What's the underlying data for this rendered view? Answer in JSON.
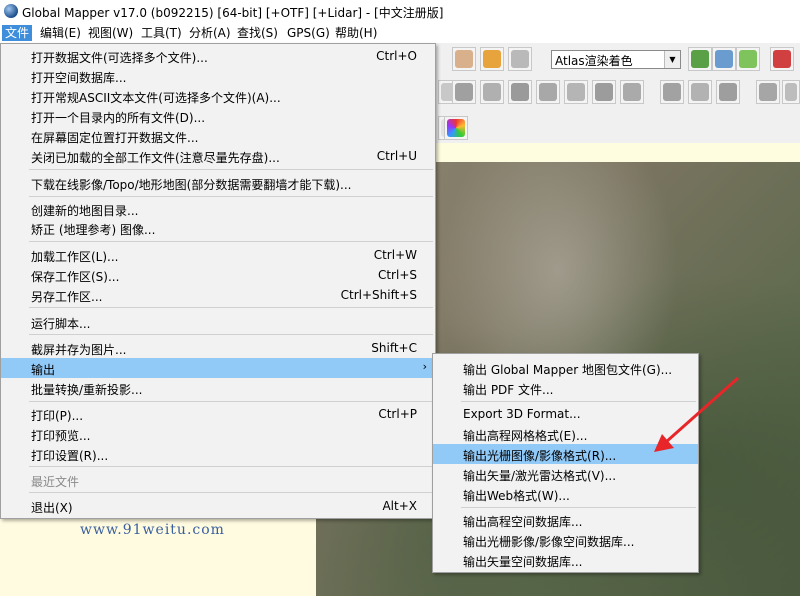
{
  "window": {
    "title": "Global Mapper v17.0 (b092215) [64-bit] [+OTF] [+Lidar] - [中文注册版]"
  },
  "menubar": [
    {
      "label": "文件",
      "active": true
    },
    {
      "label": "编辑(E)"
    },
    {
      "label": "视图(W)"
    },
    {
      "label": "工具(T)"
    },
    {
      "label": "分析(A)"
    },
    {
      "label": "查找(S)"
    },
    {
      "label": "GPS(G)"
    },
    {
      "label": "帮助(H)"
    }
  ],
  "toolbar": {
    "render_mode": "Atlas渲染着色"
  },
  "file_menu": [
    {
      "label": "打开数据文件(可选择多个文件)...",
      "shortcut": "Ctrl+O"
    },
    {
      "label": "打开空间数据库...",
      "shortcut": ""
    },
    {
      "label": "打开常规ASCII文本文件(可选择多个文件)(A)...",
      "shortcut": ""
    },
    {
      "label": "打开一个目录内的所有文件(D)...",
      "shortcut": ""
    },
    {
      "label": "在屏幕固定位置打开数据文件...",
      "shortcut": ""
    },
    {
      "label": "关闭已加载的全部工作文件(注意尽量先存盘)...",
      "shortcut": "Ctrl+U"
    },
    {
      "label": "下载在线影像/Topo/地形地图(部分数据需要翻墙才能下载)...",
      "shortcut": ""
    },
    {
      "label": "创建新的地图目录...",
      "shortcut": ""
    },
    {
      "label": "矫正 (地理参考) 图像...",
      "shortcut": ""
    },
    {
      "label": "加载工作区(L)...",
      "shortcut": "Ctrl+W"
    },
    {
      "label": "保存工作区(S)...",
      "shortcut": "Ctrl+S"
    },
    {
      "label": "另存工作区...",
      "shortcut": "Ctrl+Shift+S"
    },
    {
      "label": "运行脚本...",
      "shortcut": ""
    },
    {
      "label": "截屏并存为图片...",
      "shortcut": "Shift+C"
    },
    {
      "label": "输出",
      "shortcut": "",
      "submenu_arrow": "›"
    },
    {
      "label": "批量转换/重新投影...",
      "shortcut": ""
    },
    {
      "label": "打印(P)...",
      "shortcut": "Ctrl+P"
    },
    {
      "label": "打印预览...",
      "shortcut": ""
    },
    {
      "label": "打印设置(R)...",
      "shortcut": ""
    },
    {
      "label": "最近文件",
      "shortcut": ""
    },
    {
      "label": "退出(X)",
      "shortcut": "Alt+X"
    }
  ],
  "export_submenu": [
    {
      "label": "输出 Global Mapper 地图包文件(G)..."
    },
    {
      "label": "输出 PDF 文件..."
    },
    {
      "label": "Export 3D Format..."
    },
    {
      "label": "输出高程网格格式(E)..."
    },
    {
      "label": "输出光栅图像/影像格式(R)..."
    },
    {
      "label": "输出矢量/激光雷达格式(V)..."
    },
    {
      "label": "输出Web格式(W)..."
    },
    {
      "label": "输出高程空间数据库..."
    },
    {
      "label": "输出光栅影像/影像空间数据库..."
    },
    {
      "label": "输出矢量空间数据库..."
    }
  ],
  "watermark": "www.91weitu.com",
  "colors": {
    "highlight": "#91c9f7",
    "menu_active": "#3e8edc",
    "arrow": "#e8262a"
  }
}
